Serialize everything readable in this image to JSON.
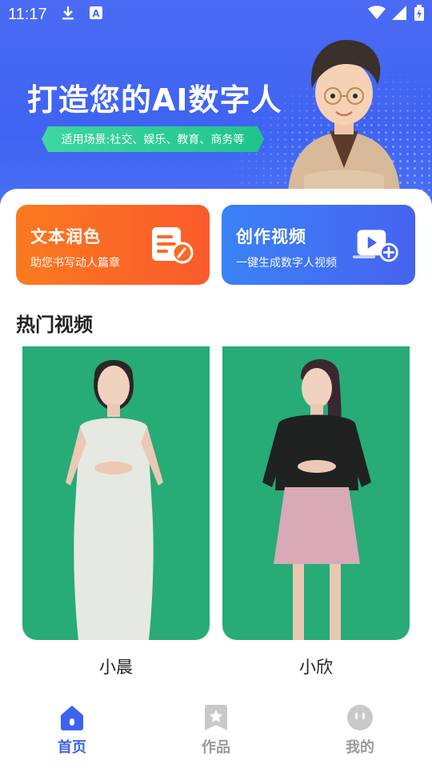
{
  "status_bar": {
    "time": "11:17",
    "left_icons": [
      "download-icon",
      "a-letter-icon"
    ],
    "right_icons": [
      "wifi-icon",
      "signal-icon",
      "battery-charging-icon"
    ]
  },
  "hero": {
    "title": "打造您的AI数字人",
    "tag": "适用场景:社交、娱乐、教育、商务等"
  },
  "actions": [
    {
      "title": "文本润色",
      "subtitle": "助您书写动人篇章",
      "icon": "document-edit-icon"
    },
    {
      "title": "创作视频",
      "subtitle": "一键生成数字人视频",
      "icon": "video-add-icon"
    }
  ],
  "hot_videos": {
    "title": "热门视频",
    "items": [
      {
        "name": "小晨"
      },
      {
        "name": "小欣"
      }
    ]
  },
  "tabbar": {
    "tabs": [
      {
        "label": "首页",
        "icon": "home-icon",
        "active": true
      },
      {
        "label": "作品",
        "icon": "star-bookmark-icon",
        "active": false
      },
      {
        "label": "我的",
        "icon": "face-icon",
        "active": false
      }
    ]
  },
  "colors": {
    "hero_blue": "#3f63f2",
    "orange": "#fa6a24",
    "blue_card": "#4269f2",
    "green_bg": "#27ab77",
    "active_tab": "#3b63f2",
    "inactive_tab": "#9a9a9a"
  }
}
